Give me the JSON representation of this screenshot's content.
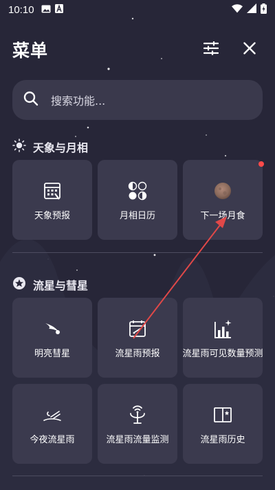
{
  "status_bar": {
    "time": "10:10",
    "left_icons": [
      "image-icon",
      "a-square-icon"
    ],
    "right_icons": [
      "wifi-icon",
      "signal-icon",
      "battery-charging-icon"
    ]
  },
  "header": {
    "title": "菜单",
    "actions": [
      "sliders-icon",
      "close-icon"
    ]
  },
  "search": {
    "placeholder": "搜索功能..."
  },
  "sections": [
    {
      "title": "天象与月相",
      "icon": "sun-icon",
      "tiles": [
        {
          "label": "天象预报",
          "icon": "calendar-grid-icon",
          "badge": false
        },
        {
          "label": "月相日历",
          "icon": "moon-phases-icon",
          "badge": false
        },
        {
          "label": "下一场月食",
          "icon": "eclipse-moon-icon",
          "badge": true
        }
      ]
    },
    {
      "title": "流星与彗星",
      "icon": "star-circle-icon",
      "tiles": [
        {
          "label": "明亮彗星",
          "icon": "comet-icon",
          "badge": false
        },
        {
          "label": "流星雨预报",
          "icon": "meteor-calendar-icon",
          "badge": false
        },
        {
          "label": "流星雨可见数量预测",
          "icon": "bar-chart-star-icon",
          "badge": false
        },
        {
          "label": "今夜流星雨",
          "icon": "shooting-star-icon",
          "badge": false
        },
        {
          "label": "流星雨流量监测",
          "icon": "antenna-icon",
          "badge": false
        },
        {
          "label": "流星雨历史",
          "icon": "book-star-icon",
          "badge": false
        }
      ]
    }
  ],
  "colors": {
    "background": "#272638",
    "tile": "#3b3a4e",
    "search": "#3a394c",
    "badge": "#ff4a4a",
    "annotation_arrow": "#e04848"
  }
}
